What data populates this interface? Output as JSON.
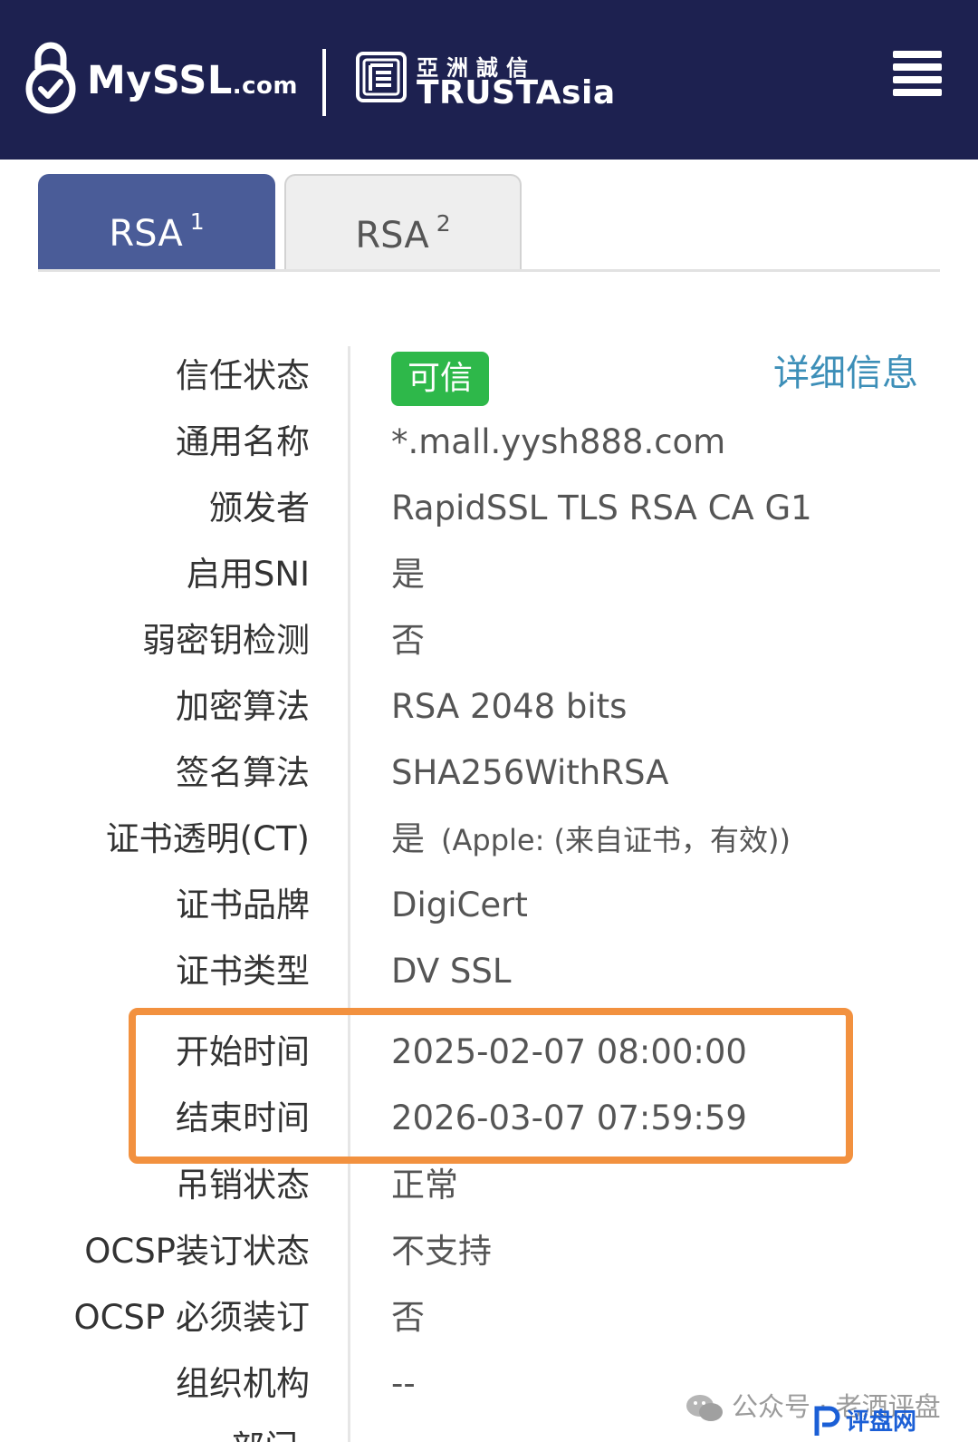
{
  "header": {
    "logo_text": "MySSL",
    "logo_suffix": ".com",
    "partner_cn": "亞洲誠信",
    "partner_en": "TRUSTAsia"
  },
  "tabs": [
    {
      "label": "RSA",
      "sup": "1",
      "active": true
    },
    {
      "label": "RSA",
      "sup": "2",
      "active": false
    }
  ],
  "trust": {
    "badge": "可信",
    "details_link": "详细信息"
  },
  "rows": [
    {
      "label": "信任状态",
      "value": ""
    },
    {
      "label": "通用名称",
      "value": "*.mall.yysh888.com"
    },
    {
      "label": "颁发者",
      "value": "RapidSSL TLS RSA CA G1"
    },
    {
      "label": "启用SNI",
      "value": "是"
    },
    {
      "label": "弱密钥检测",
      "value": "否"
    },
    {
      "label": "加密算法",
      "value": "RSA 2048 bits"
    },
    {
      "label": "签名算法",
      "value": "SHA256WithRSA"
    },
    {
      "label": "证书透明(CT)",
      "value": "是",
      "extra": "(Apple: (来自证书，有效))"
    },
    {
      "label": "证书品牌",
      "value": "DigiCert"
    },
    {
      "label": "证书类型",
      "value": "DV SSL"
    },
    {
      "label": "开始时间",
      "value": "2025-02-07 08:00:00"
    },
    {
      "label": "结束时间",
      "value": "2026-03-07 07:59:59"
    },
    {
      "label": "吊销状态",
      "value": "正常"
    },
    {
      "label": "OCSP装订状态",
      "value": "不支持"
    },
    {
      "label": "OCSP 必须装订",
      "value": "否"
    },
    {
      "label": "组织机构",
      "value": "--"
    }
  ],
  "partial_row_label": "部门",
  "watermark": {
    "text": "公众号 · 老酒评盘",
    "logo_text": "评盘网"
  },
  "colors": {
    "header_bg": "#1d2150",
    "tab_active": "#4a5c98",
    "badge_green": "#2eb84a",
    "link_blue": "#3d8fb8",
    "highlight_orange": "#f2913f"
  }
}
